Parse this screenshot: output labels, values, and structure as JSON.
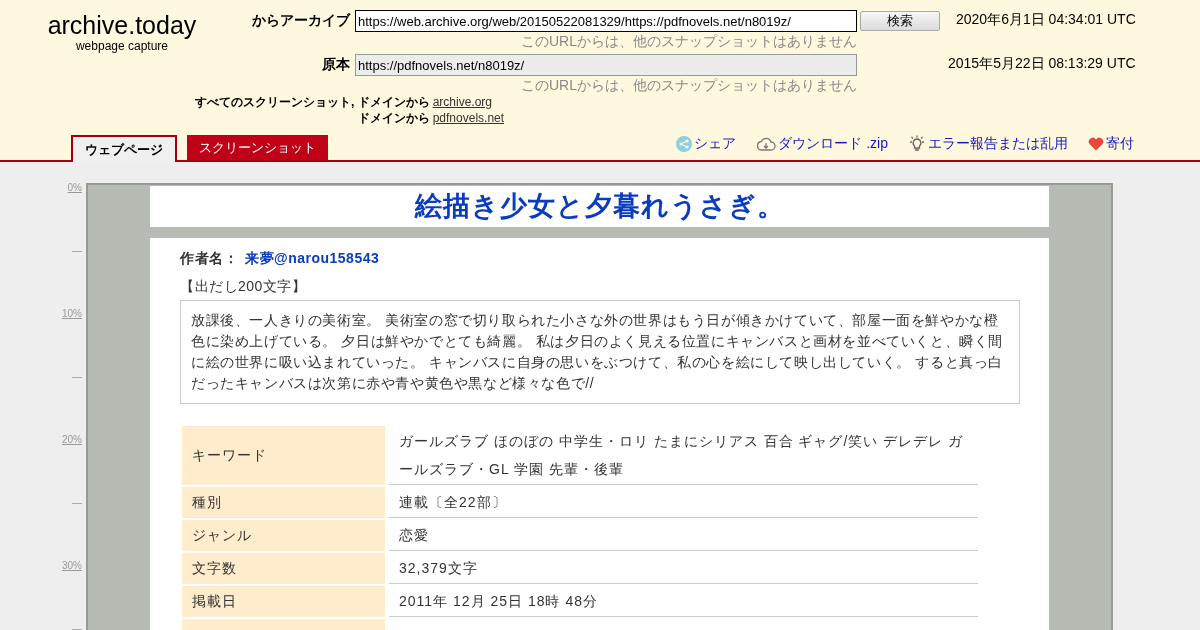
{
  "logo": {
    "title": "archive.today",
    "subtitle": "webpage capture"
  },
  "archived": {
    "label": "からアーカイブ",
    "url": "https://web.archive.org/web/20150522081329/https://pdfnovels.net/n8019z/",
    "note": "このURLからは、他のスナップショットはありません",
    "button": "検索",
    "date": "2020年6月1日 04:34:01 UTC"
  },
  "original": {
    "label": "原本",
    "url": "https://pdfnovels.net/n8019z/",
    "note": "このURLからは、他のスナップショットはありません",
    "date": "2015年5月22日 08:13:29 UTC"
  },
  "domain_links": [
    {
      "label": "すべてのスクリーンショット, ドメインから",
      "link": "archive.org"
    },
    {
      "label": "ドメインから",
      "link": "pdfnovels.net"
    }
  ],
  "tabs": [
    {
      "label": "ウェブページ",
      "selected": true
    },
    {
      "label": "スクリーンショット",
      "selected": false
    }
  ],
  "actions": [
    {
      "kind": "share",
      "label": "シェア"
    },
    {
      "kind": "download",
      "label": "ダウンロード .zip"
    },
    {
      "kind": "report",
      "label": "エラー報告または乱用"
    },
    {
      "kind": "donate",
      "label": "寄付"
    }
  ],
  "ruler": [
    "0%",
    "—",
    "10%",
    "—",
    "20%",
    "—",
    "30%",
    "—"
  ],
  "page": {
    "title": "絵描き少女と夕暮れうさぎ。",
    "author_label": "作者名：",
    "author": "来夢@narou158543",
    "excerpt_label": "【出だし200文字】",
    "excerpt": "放課後、一人きりの美術室。 美術室の窓で切り取られた小さな外の世界はもう日が傾きかけていて、部屋一面を鮮やかな橙色に染め上げている。 夕日は鮮やかでとても綺麗。 私は夕日のよく見える位置にキャンバスと画材を並べていくと、瞬く間に絵の世界に吸い込まれていった。 キャンバスに自身の思いをぶつけて、私の心を絵にして映し出していく。 すると真っ白だったキャンバスは次第に赤や青や黄色や黒など様々な色で//",
    "rows": [
      {
        "label": "キーワード",
        "value": "ガールズラブ ほのぼの 中学生・ロリ たまにシリアス 百合 ギャグ/笑い デレデレ ガールズラブ・GL 学園 先輩・後輩"
      },
      {
        "label": "種別",
        "value": "連載〔全22部〕"
      },
      {
        "label": "ジャンル",
        "value": "恋愛"
      },
      {
        "label": "文字数",
        "value": "32,379文字"
      },
      {
        "label": "掲載日",
        "value": "2011年 12月 25日 18時 48分"
      }
    ]
  }
}
